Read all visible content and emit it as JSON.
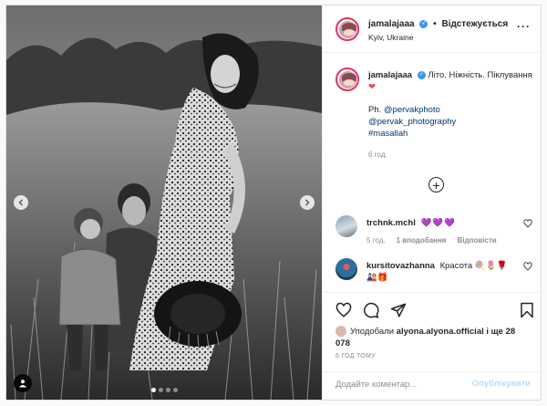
{
  "post": {
    "author": {
      "username": "jamalajaaa",
      "follow_state": "Відстежується",
      "location": "Kyiv, Ukraine"
    },
    "caption": {
      "username": "jamalajaaa",
      "text": "Літо. Ніжність. Піклування",
      "emoji": "❤",
      "credit_prefix": "Ph.",
      "tags": [
        "@pervakphoto",
        "@pervak_photography",
        "#masallah"
      ],
      "time": "6 год."
    },
    "comments": [
      {
        "username": "trchnk.mchl",
        "text": "💜💜💜",
        "time": "5 год.",
        "likes": "1 вподобання",
        "reply": "Відповісти"
      },
      {
        "username": "kursitovazhanna",
        "text": "Красота",
        "emoji": "🍭🌷🌹 🎎🎁"
      }
    ],
    "likes": {
      "prefix": "Уподобали",
      "user": "alyona.alyona.official",
      "suffix": "і ще 28 078"
    },
    "posted_time": "6 ГОД ТОМУ",
    "comment_input": {
      "placeholder": "Додайте коментар..."
    },
    "publish_label": "Опублікувати"
  },
  "colors": {
    "accent": "#3897f0",
    "publish_disabled": "#b2dffc",
    "link": "#00376b",
    "border": "#dbdbdb"
  },
  "icons": [
    "chevron-left-icon",
    "chevron-right-icon",
    "user-tag-icon",
    "verified-badge-icon",
    "more-icon",
    "plus-circle-icon",
    "heart-icon",
    "comment-icon",
    "share-icon",
    "bookmark-icon"
  ]
}
